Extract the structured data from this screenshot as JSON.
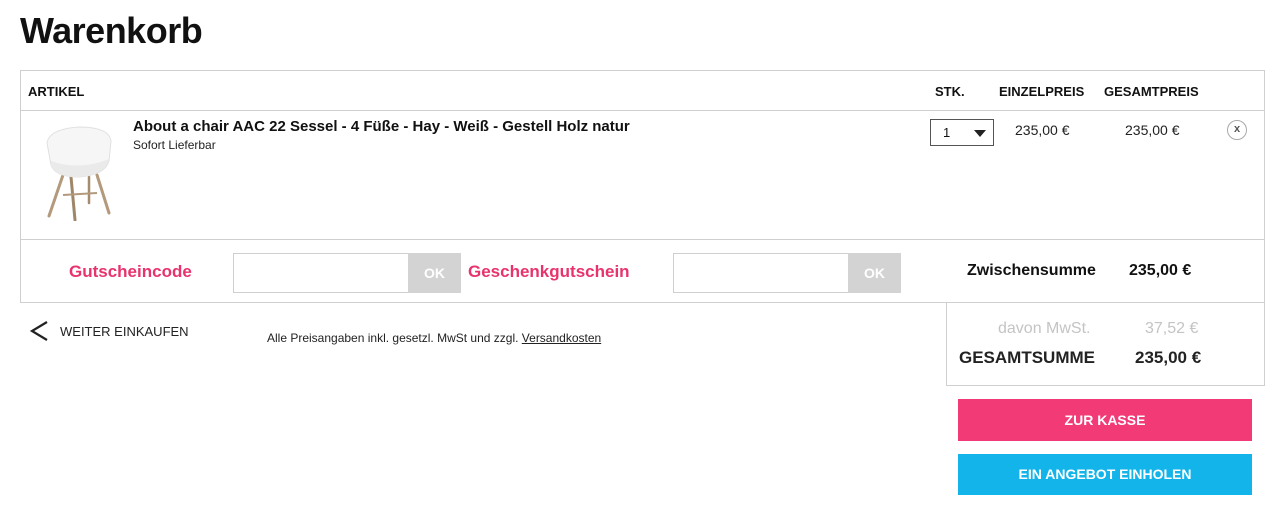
{
  "page": {
    "title": "Warenkorb"
  },
  "table": {
    "headers": {
      "artikel": "ARTIKEL",
      "stk": "STK.",
      "einzelpreis": "EINZELPREIS",
      "gesamtpreis": "GESAMTPREIS"
    },
    "items": [
      {
        "name": "About a chair AAC 22 Sessel - 4 Füße - Hay - Weiß - Gestell Holz natur",
        "availability": "Sofort Lieferbar",
        "quantity": "1",
        "unit_price": "235,00 €",
        "total_price": "235,00 €",
        "remove_label": "x",
        "image_icon": "white-chair-product-image"
      }
    ]
  },
  "vouchers": {
    "coupon_label": "Gutscheincode",
    "coupon_value": "",
    "coupon_button": "OK",
    "gift_label": "Geschenkgutschein",
    "gift_value": "",
    "gift_button": "OK"
  },
  "subtotal": {
    "label": "Zwischensumme",
    "value": "235,00 €"
  },
  "continue_shopping": {
    "label": "WEITER EINKAUFEN",
    "icon": "chevron-left-icon"
  },
  "price_note": {
    "text": "Alle Preisangaben inkl. gesetzl. MwSt und zzgl. ",
    "link": "Versandkosten"
  },
  "totals": {
    "vat_label": "davon MwSt.",
    "vat_value": "37,52 €",
    "grand_label": "GESAMTSUMME",
    "grand_value": "235,00 €"
  },
  "actions": {
    "checkout": "ZUR KASSE",
    "quote": "EIN ANGEBOT EINHOLEN"
  },
  "colors": {
    "accent_pink": "#e8336d",
    "checkout_pink": "#f23a77",
    "quote_blue": "#12b4e9",
    "border_gray": "#cfcfcf",
    "muted_gray": "#c4c4c4"
  }
}
